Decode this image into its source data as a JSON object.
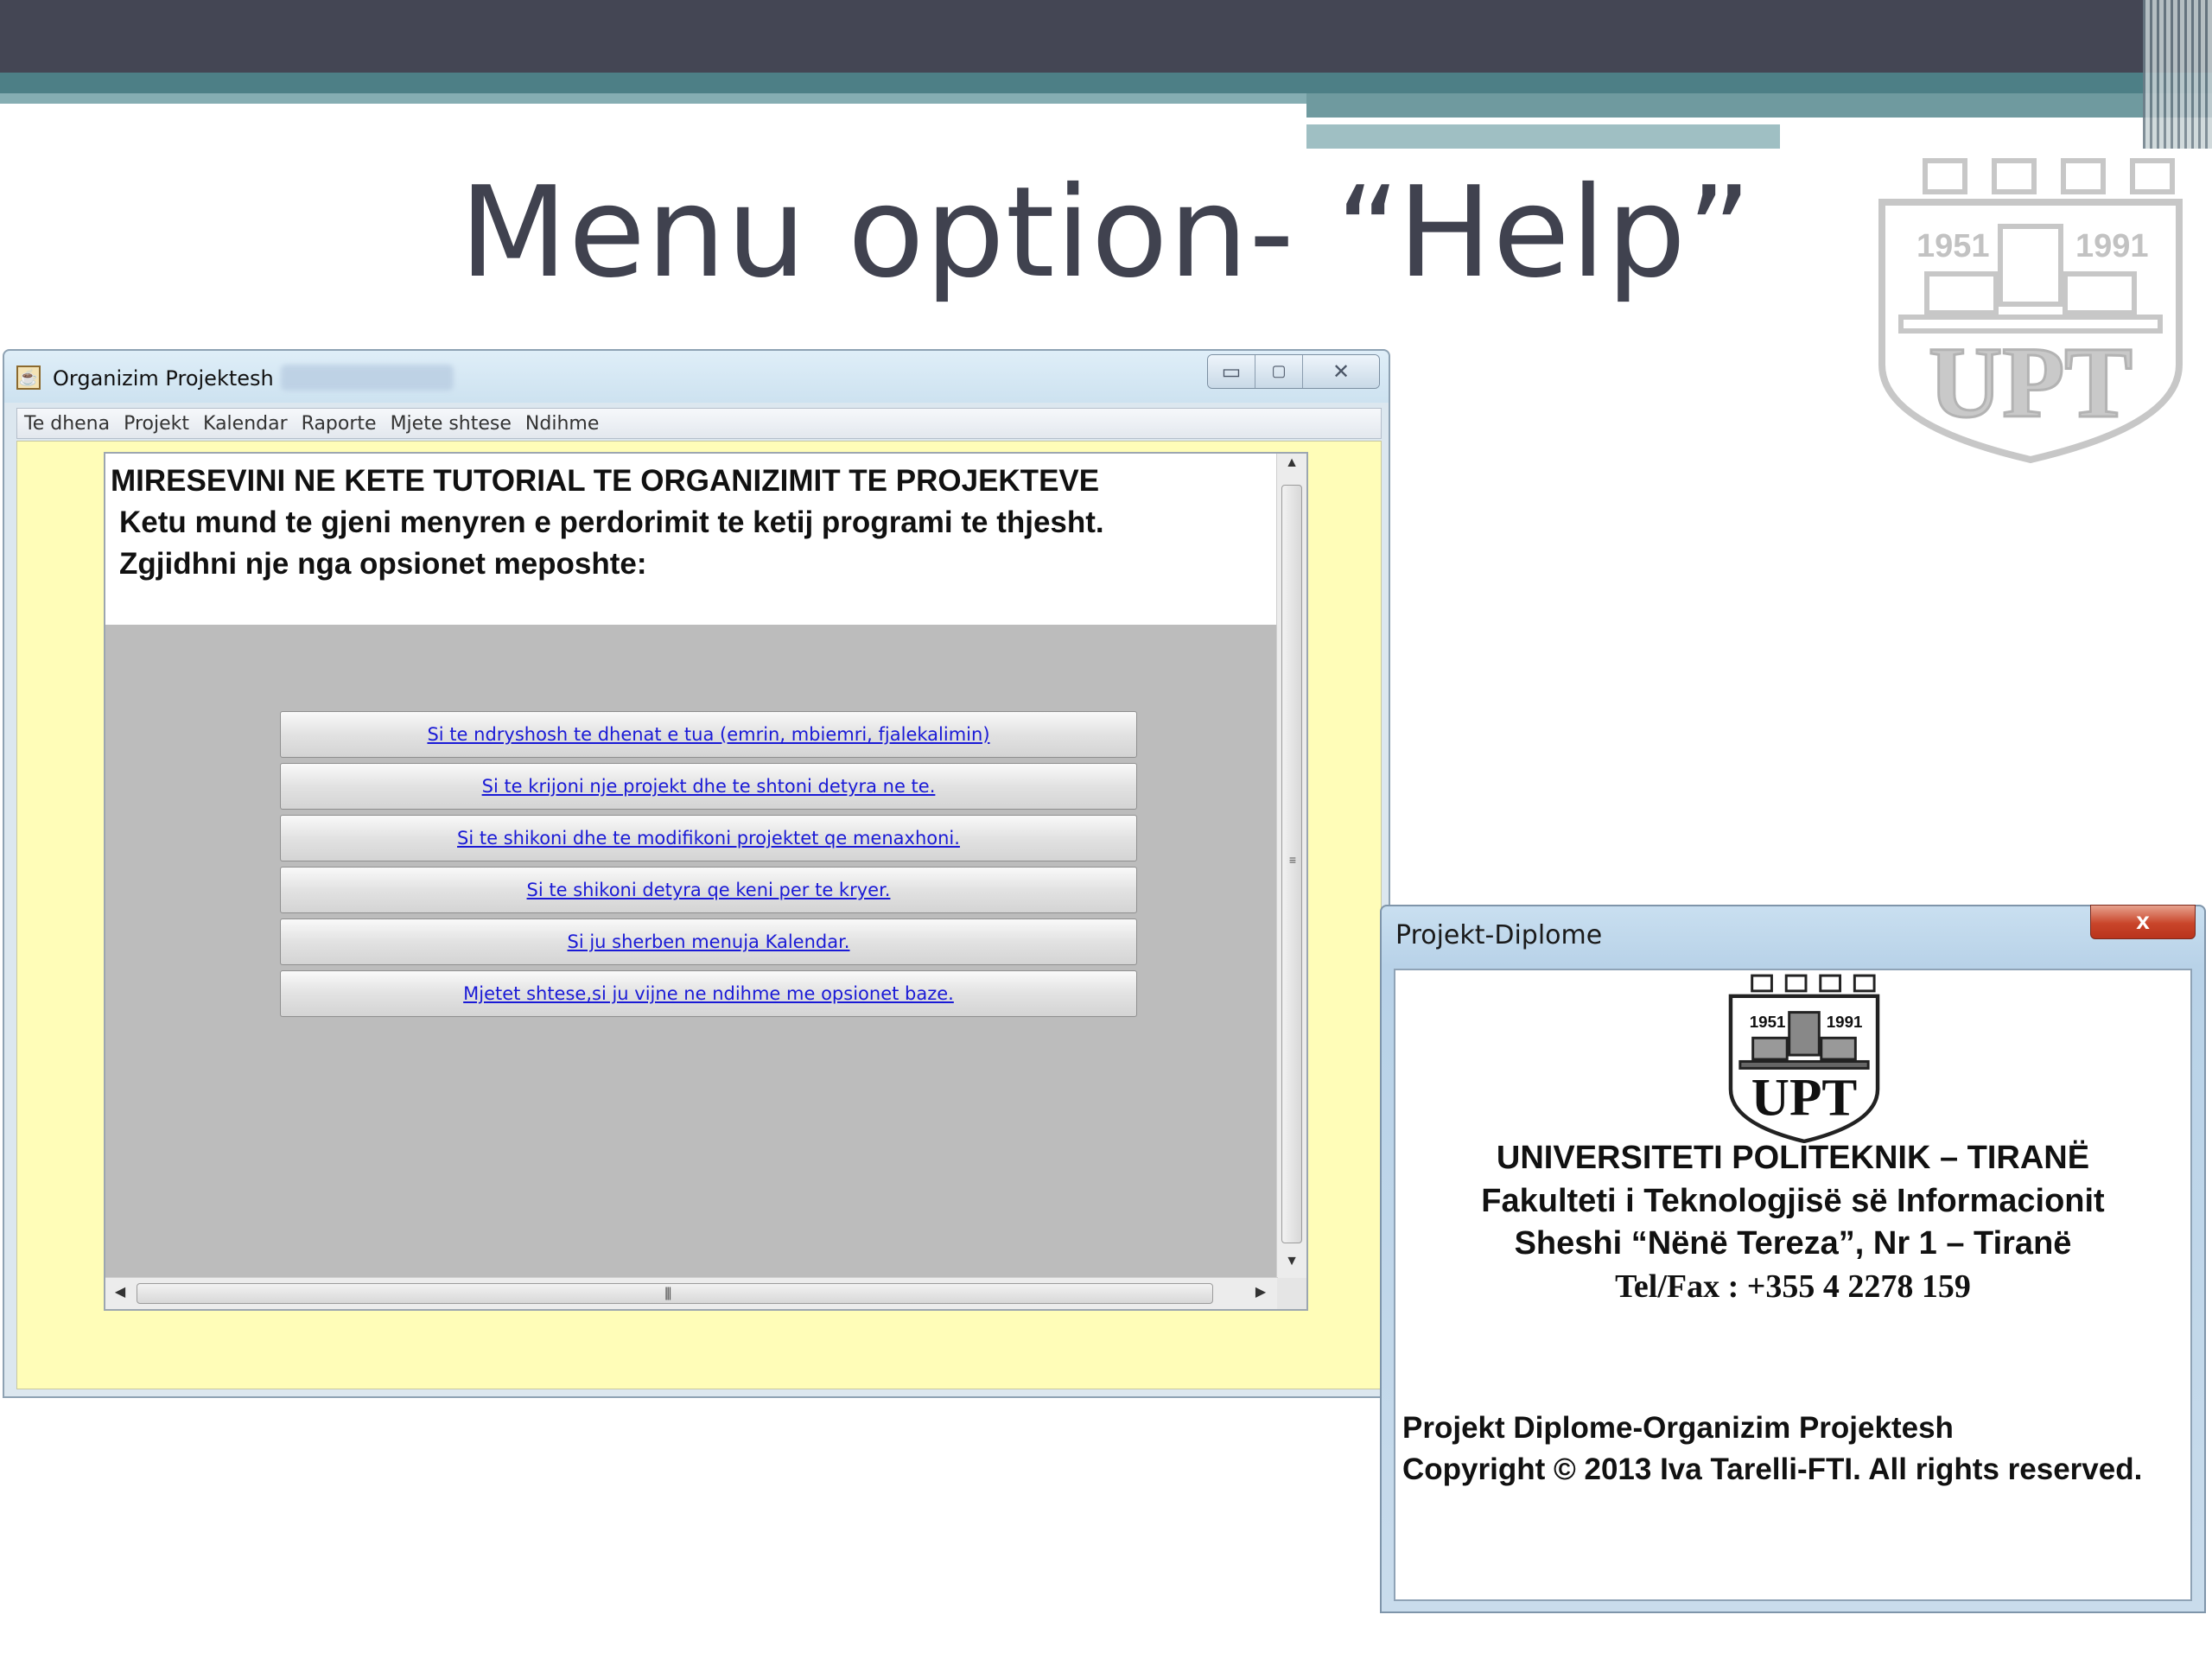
{
  "slide": {
    "title": "Menu option- “Help”",
    "logo": {
      "years_left": "1951",
      "years_right": "1991",
      "text": "UPT"
    }
  },
  "main_window": {
    "title": "Organizim Projektesh",
    "menu": [
      "Te dhena",
      "Projekt",
      "Kalendar",
      "Raporte",
      "Mjete shtese",
      "Ndihme"
    ],
    "heading": "MIRESEVINI NE KETE TUTORIAL TE ORGANIZIMIT TE PROJEKTEVE",
    "intro_1": "Ketu mund te gjeni menyren e perdorimit te ketij programi te thjesht.",
    "intro_2": "Zgjidhni nje nga opsionet meposhte:",
    "help_links": [
      "Si te ndryshosh te dhenat e tua (emrin, mbiemri, fjalekalimin)",
      "Si te krijoni nje projekt dhe te shtoni detyra ne te.",
      "Si te shikoni dhe te modifikoni projektet qe menaxhoni.",
      "Si te shikoni detyra qe keni per te kryer.",
      "Si ju sherben menuja Kalendar.",
      "Mjetet shtese,si ju vijne ne ndihme me opsionet baze."
    ],
    "colors": {
      "client_bg": "#fffdb8",
      "link": "#1a1ad6"
    }
  },
  "about_dialog": {
    "title": "Projekt-Diplome",
    "close_label": "x",
    "logo": {
      "years_left": "1951",
      "years_right": "1991",
      "text": "UPT"
    },
    "university": "UNIVERSITETI POLITEKNIK – TIRANË",
    "faculty": "Fakulteti i Teknologjisë së Informacionit",
    "address": "Sheshi “Nënë Tereza”, Nr 1 – Tiranë",
    "phone": "Tel/Fax : +355 4 2278 159",
    "project": "Projekt Diplome-Organizim Projektesh",
    "copyright": "Copyright © 2013 Iva Tarelli-FTI. All rights reserved."
  }
}
